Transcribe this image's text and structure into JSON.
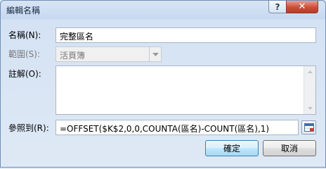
{
  "window": {
    "title": "編輯名稱"
  },
  "titlebar": {
    "help_glyph": "?",
    "close_glyph": "✕"
  },
  "fields": {
    "name": {
      "label": "名稱(N):",
      "value": "完整區名"
    },
    "scope": {
      "label": "範圍(S):",
      "value": "活頁簿"
    },
    "comment": {
      "label": "註解(O):",
      "value": ""
    },
    "refers_to": {
      "label": "參照到(R):",
      "value": "=OFFSET($K$2,0,0,COUNTA(區名)-COUNT(區名),1)"
    }
  },
  "buttons": {
    "ok": "確定",
    "cancel": "取消"
  }
}
